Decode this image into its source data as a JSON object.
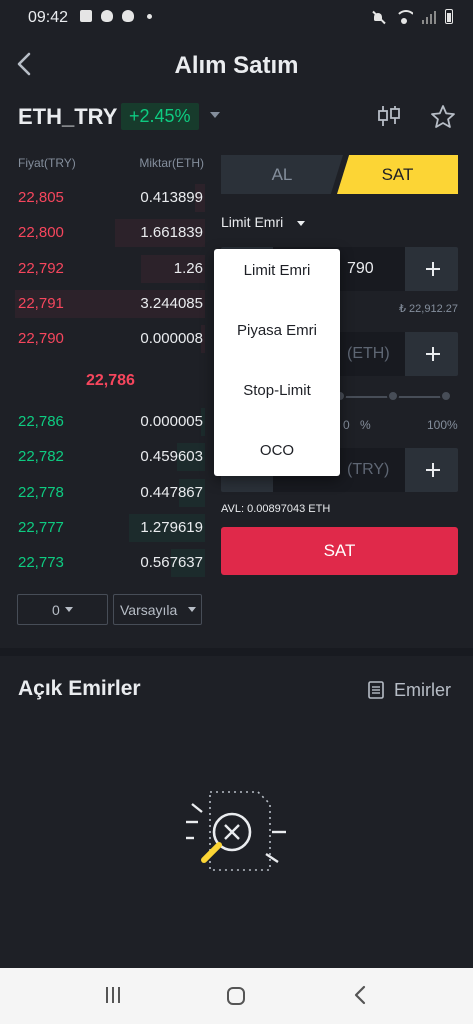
{
  "status_bar": {
    "time": "09:42"
  },
  "header": {
    "title": "Alım Satım"
  },
  "pair": {
    "name": "ETH_TRY",
    "change": "+2.45%"
  },
  "order_book": {
    "price_header": "Fiyat(TRY)",
    "qty_header": "Miktar(ETH)",
    "asks": [
      {
        "price": "22,805",
        "qty": "0.413899",
        "depth": 0.05
      },
      {
        "price": "22,800",
        "qty": "1.661839",
        "depth": 0.45
      },
      {
        "price": "22,792",
        "qty": "1.26",
        "depth": 0.32
      },
      {
        "price": "22,791",
        "qty": "3.244085",
        "depth": 0.95
      },
      {
        "price": "22,790",
        "qty": "0.000008",
        "depth": 0.02
      }
    ],
    "mid_price": "22,786",
    "bids": [
      {
        "price": "22,786",
        "qty": "0.000005",
        "depth": 0.02
      },
      {
        "price": "22,782",
        "qty": "0.459603",
        "depth": 0.14
      },
      {
        "price": "22,778",
        "qty": "0.447867",
        "depth": 0.13
      },
      {
        "price": "22,777",
        "qty": "1.279619",
        "depth": 0.38
      },
      {
        "price": "22,773",
        "qty": "0.567637",
        "depth": 0.17
      }
    ],
    "depth_select": "0",
    "view_select": "Varsayıla"
  },
  "trade": {
    "buy_tab": "AL",
    "sell_tab": "SAT",
    "order_type": "Limit Emri",
    "price_value": "790",
    "price_estimate": "₺ 22,912.27",
    "amount_placeholder": "(ETH)",
    "percent_value": "0",
    "percent_sign": "%",
    "percent_max": "100%",
    "total_placeholder": "(TRY)",
    "available": "AVL: 0.00897043 ETH",
    "submit": "SAT"
  },
  "order_type_menu": {
    "items": [
      "Limit Emri",
      "Piyasa Emri",
      "Stop-Limit",
      "OCO"
    ]
  },
  "open_orders": {
    "title": "Açık Emirler",
    "link": "Emirler"
  },
  "colors": {
    "background": "#1e2026",
    "ask": "#f6465d",
    "bid": "#0ecb81",
    "accent": "#fcd535",
    "sell_button": "#e0294a"
  }
}
